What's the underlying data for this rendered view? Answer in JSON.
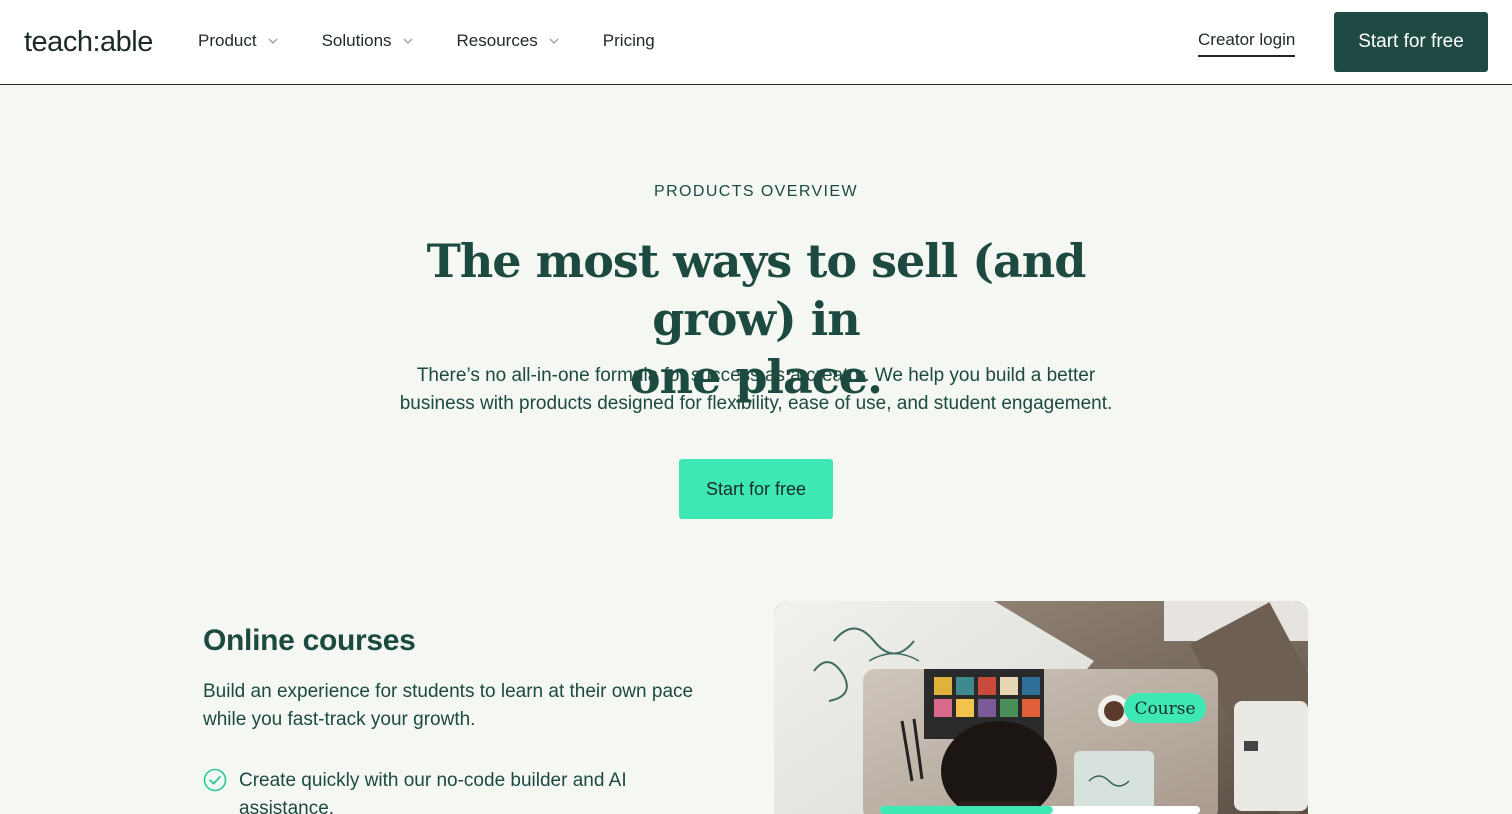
{
  "header": {
    "logo": "teach:able",
    "nav": [
      {
        "label": "Product",
        "has_dropdown": true
      },
      {
        "label": "Solutions",
        "has_dropdown": true
      },
      {
        "label": "Resources",
        "has_dropdown": true
      },
      {
        "label": "Pricing",
        "has_dropdown": false
      }
    ],
    "creator_login": "Creator login",
    "cta": "Start for free"
  },
  "hero": {
    "eyebrow": "PRODUCTS OVERVIEW",
    "headline_line1": "The most ways to sell (and grow) in",
    "headline_line2": "one place.",
    "subtitle_line1": "There’s no all-in-one formula for success as a creator. We help you build a better",
    "subtitle_line2": "business with products designed for flexibility, ease of use, and student engagement.",
    "cta": "Start for free"
  },
  "feature": {
    "title": "Online courses",
    "description": "Build an experience for students to learn at their own pace while you fast-track your growth.",
    "check_item": "Create quickly with our no-code builder and AI assistance.",
    "image_badge": "Course",
    "progress": 0.54
  },
  "colors": {
    "brand_dark": "#1f4a43",
    "brand_mint": "#3ee8b5",
    "page_bg": "#f5f7f2",
    "text": "#1d4a40"
  },
  "icons": {
    "nav_dropdown": "chevron-down-icon",
    "feature_check": "check-circle-icon"
  }
}
